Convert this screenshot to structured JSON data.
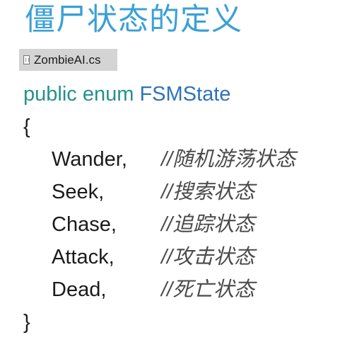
{
  "title": "僵尸状态的定义",
  "file_tab": {
    "icon": "file-icon",
    "name": "ZombieAI.cs"
  },
  "code": {
    "keyword_public": "public",
    "keyword_enum": "enum",
    "type_name": "FSMState",
    "open_brace": "{",
    "close_brace": "}",
    "members": [
      {
        "name": "Wander,",
        "comment": "//随机游荡状态"
      },
      {
        "name": "Seek,",
        "comment": "//搜索状态"
      },
      {
        "name": "Chase,",
        "comment": "//追踪状态"
      },
      {
        "name": "Attack,",
        "comment": "//攻击状态"
      },
      {
        "name": "Dead,",
        "comment": "//死亡状态"
      }
    ]
  },
  "colors": {
    "title": "#3aa0d6",
    "keyword": "#25918e",
    "type": "#2f73b8",
    "text": "#1b1b1b",
    "tab_background": "#d4d4d4"
  }
}
